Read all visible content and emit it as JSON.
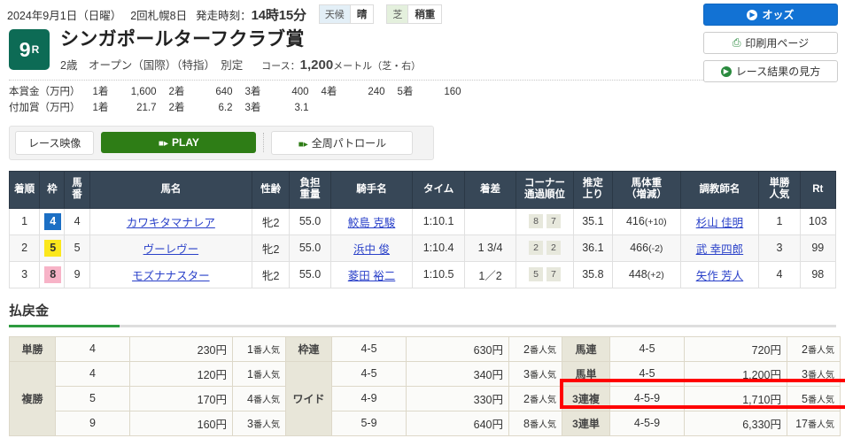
{
  "header": {
    "date": "2024年9月1日（日曜）",
    "meeting": "2回札幌8日",
    "post_label": "発走時刻：",
    "post_time": "14時15分",
    "weather_label": "天候",
    "weather_value": "晴",
    "track_label": "芝",
    "track_value": "稍重",
    "race_number": "9",
    "race_number_suffix": "R",
    "race_name": "シンガポールターフクラブ賞",
    "conditions": "2歳　オープン（国際）（特指）　別定",
    "course_label": "コース：",
    "course_distance": "1,200",
    "course_unit": "メートル（芝・右）"
  },
  "prize": {
    "row1_label": "本賞金（万円）",
    "row2_label": "付加賞（万円）",
    "positions": [
      "1着",
      "2着",
      "3着",
      "4着",
      "5着"
    ],
    "main": [
      "1,600",
      "640",
      "400",
      "240",
      "160"
    ],
    "bonus": [
      "21.7",
      "6.2",
      "3.1"
    ]
  },
  "side_buttons": [
    {
      "label": "オッズ",
      "icon": "play-circle-icon",
      "style": "primary"
    },
    {
      "label": "印刷用ページ",
      "icon": "printer-icon",
      "style": "ghost"
    },
    {
      "label": "レース結果の見方",
      "icon": "play-circle-icon",
      "style": "ghost"
    }
  ],
  "video": {
    "label": "レース映像",
    "play": "PLAY",
    "patrol": "全周パトロール",
    "camera_icon": "video-camera-icon"
  },
  "results": {
    "columns": [
      "着順",
      "枠",
      "馬番",
      "馬名",
      "性齢",
      "負担重量",
      "騎手名",
      "タイム",
      "着差",
      "コーナー通過順位",
      "推定上り",
      "馬体重（増減）",
      "調教師名",
      "単勝人気",
      "Rt"
    ],
    "columns_multiline": [
      [
        "着順"
      ],
      [
        "枠"
      ],
      [
        "馬",
        "番"
      ],
      [
        "馬名"
      ],
      [
        "性齢"
      ],
      [
        "負担",
        "重量"
      ],
      [
        "騎手名"
      ],
      [
        "タイム"
      ],
      [
        "着差"
      ],
      [
        "コーナー",
        "通過順位"
      ],
      [
        "推定",
        "上り"
      ],
      [
        "馬体重",
        "（増減）"
      ],
      [
        "調教師名"
      ],
      [
        "単勝",
        "人気"
      ],
      [
        "Rt"
      ]
    ],
    "rows": [
      {
        "place": "1",
        "frame": "4",
        "frame_color": "#1c6fc4",
        "frame_text_color": "#ffffff",
        "horse_no": "4",
        "horse": "カワキタマナレア",
        "sex_age": "牝2",
        "weight": "55.0",
        "jockey": "鮫島 克駿",
        "time": "1:10.1",
        "margin": "",
        "corners": [
          "8",
          "7"
        ],
        "last3f": "35.1",
        "body_weight": "416",
        "body_delta": "(+10)",
        "trainer": "杉山 佳明",
        "popularity": "1",
        "rt": "103"
      },
      {
        "place": "2",
        "frame": "5",
        "frame_color": "#fbe71c",
        "frame_text_color": "#333333",
        "horse_no": "5",
        "horse": "ヴーレヴー",
        "sex_age": "牝2",
        "weight": "55.0",
        "jockey": "浜中 俊",
        "time": "1:10.4",
        "margin": "1 3/4",
        "corners": [
          "2",
          "2"
        ],
        "last3f": "36.1",
        "body_weight": "466",
        "body_delta": "(-2)",
        "trainer": "武 幸四郎",
        "popularity": "3",
        "rt": "99"
      },
      {
        "place": "3",
        "frame": "8",
        "frame_color": "#f7b3c7",
        "frame_text_color": "#333333",
        "horse_no": "9",
        "horse": "モズナナスター",
        "sex_age": "牝2",
        "weight": "55.0",
        "jockey": "菱田 裕二",
        "time": "1:10.5",
        "margin": "1／2",
        "corners": [
          "5",
          "7"
        ],
        "last3f": "35.8",
        "body_weight": "448",
        "body_delta": "(+2)",
        "trainer": "矢作 芳人",
        "popularity": "4",
        "rt": "98"
      }
    ]
  },
  "payout": {
    "title": "払戻金",
    "yen": "円",
    "pop_suffix": "番人気",
    "highlight_row_key": "3連複",
    "groups": [
      {
        "col": 1,
        "blocks": [
          {
            "key": "単勝",
            "rows": [
              {
                "combo": "4",
                "amount": "230",
                "pop": "1"
              }
            ]
          },
          {
            "key": "複勝",
            "rows": [
              {
                "combo": "4",
                "amount": "120",
                "pop": "1"
              },
              {
                "combo": "5",
                "amount": "170",
                "pop": "4"
              },
              {
                "combo": "9",
                "amount": "160",
                "pop": "3"
              }
            ]
          }
        ]
      },
      {
        "col": 2,
        "blocks": [
          {
            "key": "枠連",
            "rows": [
              {
                "combo": "4-5",
                "amount": "630",
                "pop": "2"
              }
            ]
          },
          {
            "key": "ワイド",
            "rows": [
              {
                "combo": "4-5",
                "amount": "340",
                "pop": "3"
              },
              {
                "combo": "4-9",
                "amount": "330",
                "pop": "2"
              },
              {
                "combo": "5-9",
                "amount": "640",
                "pop": "8"
              }
            ]
          }
        ]
      },
      {
        "col": 3,
        "blocks": [
          {
            "key": "馬連",
            "rows": [
              {
                "combo": "4-5",
                "amount": "720",
                "pop": "2"
              }
            ]
          },
          {
            "key": "馬単",
            "rows": [
              {
                "combo": "4-5",
                "amount": "1,200",
                "pop": "3"
              }
            ]
          },
          {
            "key": "3連複",
            "rows": [
              {
                "combo": "4-5-9",
                "amount": "1,710",
                "pop": "5"
              }
            ]
          },
          {
            "key": "3連単",
            "rows": [
              {
                "combo": "4-5-9",
                "amount": "6,330",
                "pop": "17"
              }
            ]
          }
        ]
      }
    ]
  },
  "colors": {
    "accent_green": "#2e9b3f",
    "race_badge": "#0d6b55",
    "primary_blue": "#1272d4",
    "table_header": "#374757",
    "highlight_red": "#ff0000"
  }
}
